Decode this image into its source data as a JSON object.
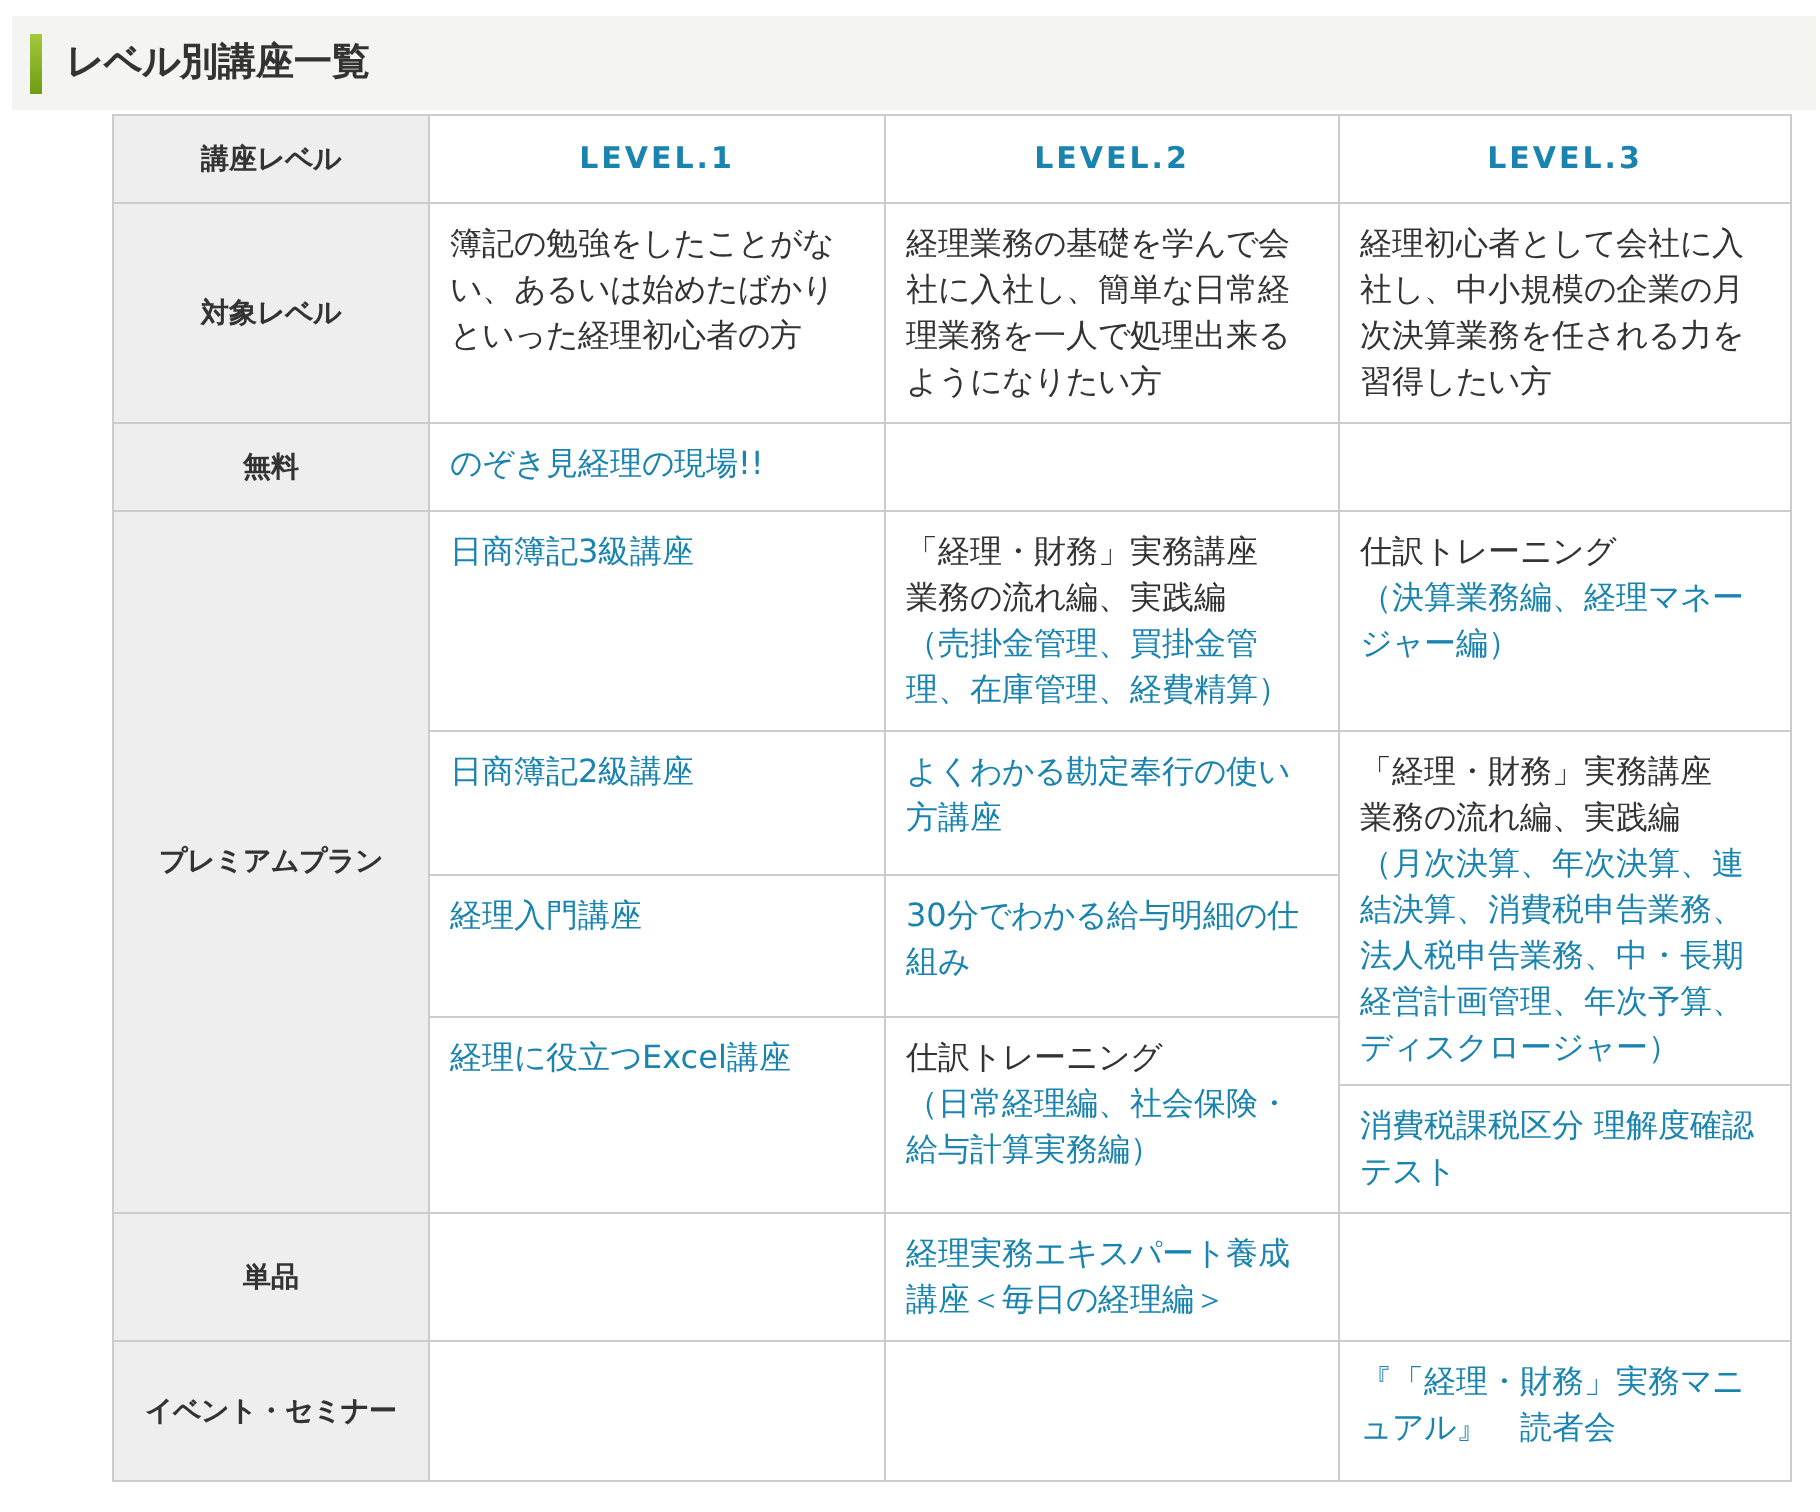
{
  "title": "レベル別講座一覧",
  "header": {
    "label": "講座レベル",
    "levels": [
      "LEVEL.1",
      "LEVEL.2",
      "LEVEL.3"
    ]
  },
  "target": {
    "label": "対象レベル",
    "cells": [
      {
        "title": "簿記の勉強をしたことがない、あるいは始めたばかりといった経理初心者の方"
      },
      {
        "title": "経理業務の基礎を学んで会社に入社し、簡単な日常経理業務を一人で処理出来るようになりたい方"
      },
      {
        "title": "経理初心者として会社に入社し、中小規模の企業の月次決算業務を任される力を習得したい方"
      }
    ]
  },
  "free": {
    "label": "無料",
    "cells": [
      {
        "link": "のぞき見経理の現場!!"
      },
      null,
      null
    ]
  },
  "premium": {
    "label": "プレミアムプラン",
    "columns": [
      [
        {
          "link": "日商簿記3級講座"
        },
        {
          "link": "日商簿記2級講座"
        },
        {
          "link": "経理入門講座"
        },
        {
          "link": "経理に役立つExcel講座"
        }
      ],
      [
        {
          "title": [
            "「経理・財務」実務講座",
            "業務の流れ編、実践編"
          ],
          "link": "（売掛金管理、買掛金管理、在庫管理、経費精算）"
        },
        {
          "link": "よくわかる勘定奉行の使い方講座"
        },
        {
          "link": "30分でわかる給与明細の仕組み"
        },
        {
          "title": "仕訳トレーニング",
          "link": "（日常経理編、社会保険・給与計算実務編）"
        }
      ],
      [
        {
          "title": "仕訳トレーニング",
          "link": "（決算業務編、経理マネージャー編）"
        },
        {
          "title": [
            "「経理・財務」実務講座",
            "業務の流れ編、実践編"
          ],
          "link": "（月次決算、年次決算、連結決算、消費税申告業務、法人税申告業務、中・長期経営計画管理、年次予算、ディスクロージャー）"
        },
        {
          "link": "消費税課税区分 理解度確認テスト"
        }
      ]
    ]
  },
  "single": {
    "label": "単品",
    "cells": [
      null,
      {
        "link": "経理実務エキスパート養成講座＜毎日の経理編＞"
      },
      null
    ]
  },
  "event": {
    "label": "イベント・セミナー",
    "cells": [
      null,
      null,
      {
        "link": "『「経理・財務」実務マニュアル』　読者会"
      }
    ]
  }
}
